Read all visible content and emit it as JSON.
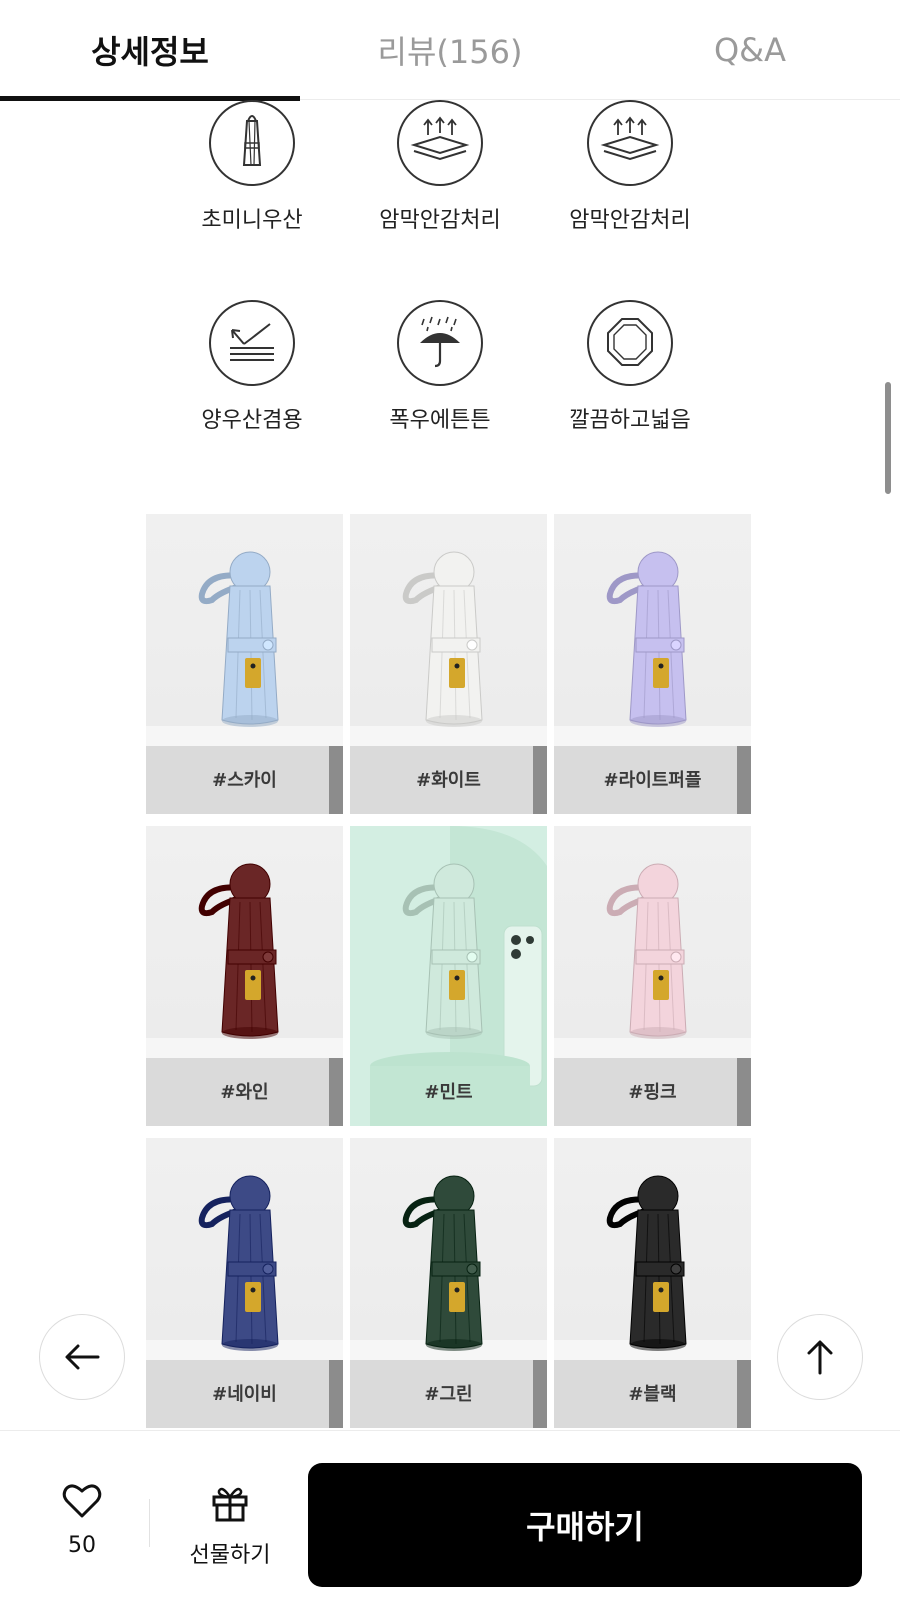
{
  "tabs": [
    {
      "label": "상세정보",
      "active": true
    },
    {
      "label": "리뷰(156)",
      "active": false
    },
    {
      "label": "Q&A",
      "active": false
    }
  ],
  "features": [
    {
      "label": "초미니우산",
      "icon": "mini-umbrella-icon"
    },
    {
      "label": "암막안감처리",
      "icon": "blackout-lining-icon"
    },
    {
      "label": "암막안감처리",
      "icon": "blackout-lining-icon"
    },
    {
      "label": "양우산겸용",
      "icon": "uv-protection-icon"
    },
    {
      "label": "폭우에튼튼",
      "icon": "rain-umbrella-icon"
    },
    {
      "label": "깔끔하고넓음",
      "icon": "octagon-canopy-icon"
    }
  ],
  "products": [
    {
      "name": "#스카이",
      "color": "#bcd3ee"
    },
    {
      "name": "#화이트",
      "color": "#f2f2f0"
    },
    {
      "name": "#라이트퍼플",
      "color": "#c6c0ef"
    },
    {
      "name": "#와인",
      "color": "#6a2626"
    },
    {
      "name": "#민트",
      "color": "#cfe9dc"
    },
    {
      "name": "#핑크",
      "color": "#f3d4dc"
    },
    {
      "name": "#네이비",
      "color": "#3d4a86"
    },
    {
      "name": "#그린",
      "color": "#2f4a3a"
    },
    {
      "name": "#블랙",
      "color": "#2a2a2a"
    }
  ],
  "nav": {
    "back_icon": "arrow-left-icon",
    "top_icon": "arrow-up-icon"
  },
  "bottom": {
    "like_count": "50",
    "gift_label": "선물하기",
    "buy_label": "구매하기"
  },
  "colors": {
    "accent": "#000000",
    "label_gold": "#d4a72c",
    "mint_bg": "#d3eee2"
  }
}
